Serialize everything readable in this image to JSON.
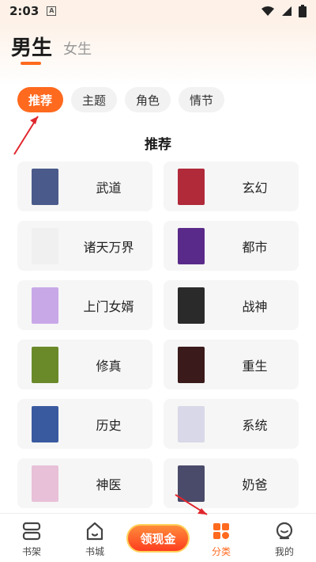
{
  "status_bar": {
    "time": "2:03",
    "notification_badge": "A"
  },
  "gender_tabs": [
    "男生",
    "女生"
  ],
  "chips": [
    "推荐",
    "主题",
    "角色",
    "情节"
  ],
  "section_title": "推荐",
  "categories": [
    {
      "label": "武道",
      "cover_color": "#4a5a8a"
    },
    {
      "label": "玄幻",
      "cover_color": "#b02a3a"
    },
    {
      "label": "诸天万界",
      "cover_color": "#f0f0f0"
    },
    {
      "label": "都市",
      "cover_color": "#5a2a8a"
    },
    {
      "label": "上门女婿",
      "cover_color": "#c9a8e8"
    },
    {
      "label": "战神",
      "cover_color": "#2a2a2a"
    },
    {
      "label": "修真",
      "cover_color": "#6a8a2a"
    },
    {
      "label": "重生",
      "cover_color": "#3a1a1a"
    },
    {
      "label": "历史",
      "cover_color": "#3a5aa0"
    },
    {
      "label": "系统",
      "cover_color": "#d8d8e8"
    },
    {
      "label": "神医",
      "cover_color": "#e8c0d8"
    },
    {
      "label": "奶爸",
      "cover_color": "#4a4a6a"
    }
  ],
  "bottom_nav": [
    {
      "label": "书架",
      "icon": "bookshelf-icon"
    },
    {
      "label": "书城",
      "icon": "home-icon"
    },
    {
      "label": "领现金",
      "icon": "cash-badge"
    },
    {
      "label": "分类",
      "icon": "category-grid-icon"
    },
    {
      "label": "我的",
      "icon": "profile-icon"
    }
  ],
  "colors": {
    "accent": "#ff6a1f",
    "annotation": "#e0272e"
  }
}
